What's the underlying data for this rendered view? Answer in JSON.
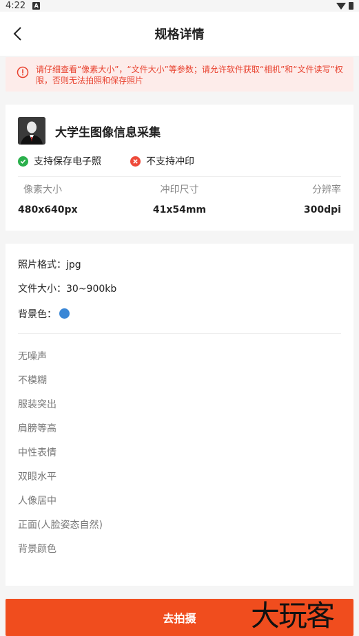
{
  "status": {
    "time": "4:22",
    "notif_icon": "A"
  },
  "nav": {
    "title": "规格详情"
  },
  "warning": {
    "text": "请仔细查看“像素大小”，“文件大小”等参数；请允许软件获取“相机”和“文件读写”权限，否则无法拍照和保存照片"
  },
  "spec_card": {
    "name": "大学生图像信息采集",
    "support_save": "支持保存电子照",
    "support_print": "不支持冲印",
    "specs": [
      {
        "label": "像素大小",
        "value": "480x640px"
      },
      {
        "label": "冲印尺寸",
        "value": "41x54mm"
      },
      {
        "label": "分辨率",
        "value": "300dpi"
      }
    ]
  },
  "details": {
    "format": "照片格式：jpg",
    "size": "文件大小：30~900kb",
    "bg_label": "背景色：",
    "bg_color": "#3a87d6",
    "requirements": [
      "无噪声",
      "不模糊",
      "服装突出",
      "肩膀等高",
      "中性表情",
      "双眼水平",
      "人像居中",
      "正面(人脸姿态自然)",
      "背景颜色"
    ]
  },
  "action": {
    "button": "去拍摄"
  },
  "watermark": "大玩客"
}
